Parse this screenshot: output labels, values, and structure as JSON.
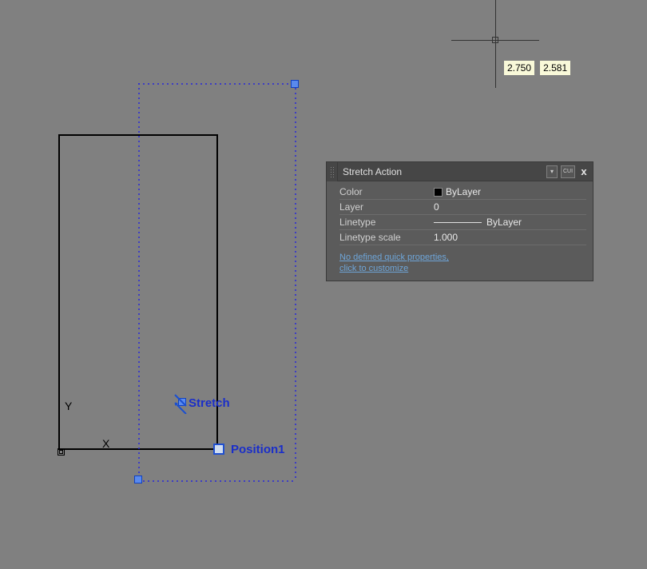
{
  "cursor": {
    "coord_x": "2.750",
    "coord_y": "2.581"
  },
  "axes": {
    "x_label": "X",
    "y_label": "Y"
  },
  "labels": {
    "stretch": "Stretch",
    "position": "Position1"
  },
  "panel": {
    "title": "Stretch Action",
    "close": "x",
    "cui": "CUI",
    "rows": {
      "color": {
        "label": "Color",
        "value": "ByLayer"
      },
      "layer": {
        "label": "Layer",
        "value": "0"
      },
      "linetype": {
        "label": "Linetype",
        "value": "ByLayer"
      },
      "linetype_scale": {
        "label": "Linetype scale",
        "value": "1.000"
      }
    },
    "footer": {
      "line1": "No defined quick properties,",
      "line2": "click to customize"
    }
  }
}
